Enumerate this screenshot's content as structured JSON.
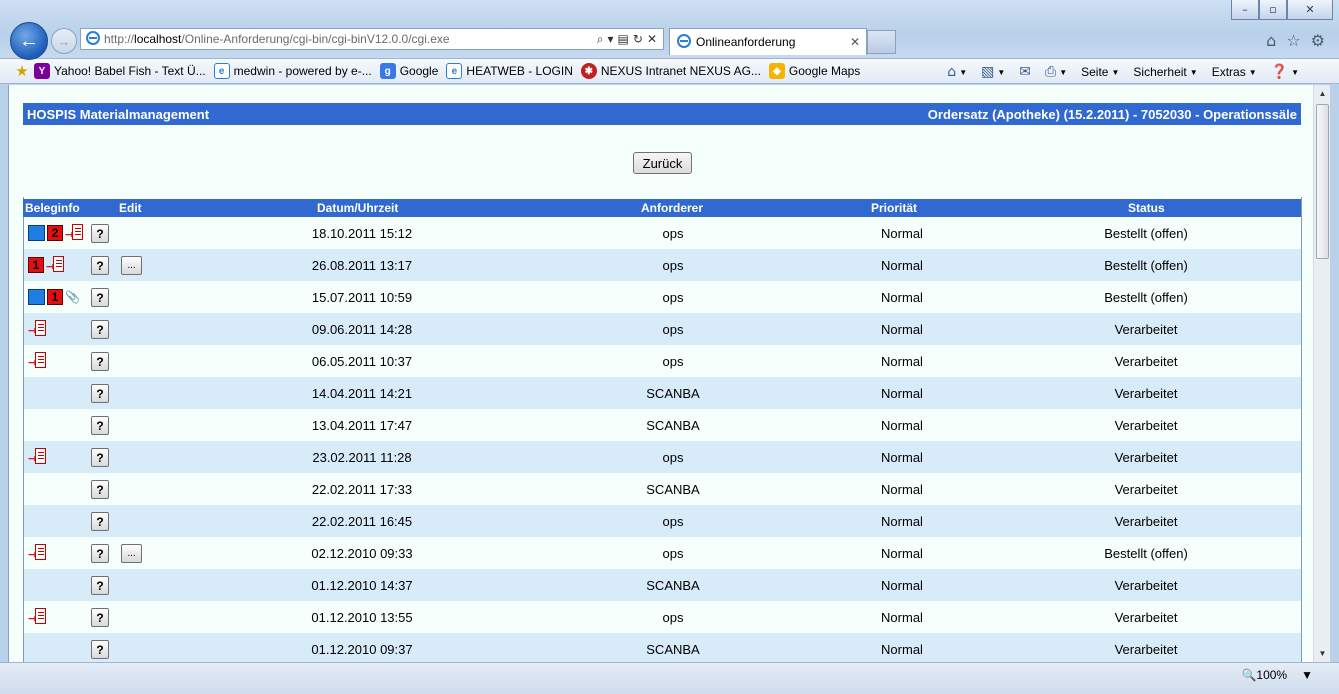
{
  "browser": {
    "address_prefix": "http://",
    "address_host": "localhost",
    "address_path": "/Online-Anforderung/cgi-bin/cgi-binV12.0.0/cgi.exe",
    "tab_title": "Onlineanforderung",
    "favorites": [
      {
        "label": "Yahoo! Babel Fish - Text Ü..."
      },
      {
        "label": "medwin - powered by e-..."
      },
      {
        "label": "Google"
      },
      {
        "label": "HEATWEB - LOGIN"
      },
      {
        "label": "NEXUS Intranet NEXUS AG..."
      },
      {
        "label": "Google Maps"
      }
    ],
    "commands": {
      "page": "Seite",
      "safety": "Sicherheit",
      "extras": "Extras"
    },
    "zoom": "100%"
  },
  "page": {
    "app_title": "HOSPIS Materialmanagement",
    "context": "Ordersatz (Apotheke) (15.2.2011) - 7052030 - Operationssäle",
    "back_button": "Zurück",
    "columns": {
      "beleginfo": "Beleginfo",
      "edit": "Edit",
      "datetime": "Datum/Uhrzeit",
      "requester": "Anforderer",
      "priority": "Priorität",
      "status": "Status"
    },
    "question_label": "?",
    "edit_label": "...",
    "rows": [
      {
        "beleg": [
          "box",
          "num:2",
          "doc"
        ],
        "edit": false,
        "datetime": "18.10.2011 15:12",
        "requester": "ops",
        "priority": "Normal",
        "status": "Bestellt (offen)"
      },
      {
        "beleg": [
          "num:1",
          "doc"
        ],
        "edit": true,
        "datetime": "26.08.2011 13:17",
        "requester": "ops",
        "priority": "Normal",
        "status": "Bestellt (offen)"
      },
      {
        "beleg": [
          "box",
          "num:1",
          "clip"
        ],
        "edit": false,
        "datetime": "15.07.2011 10:59",
        "requester": "ops",
        "priority": "Normal",
        "status": "Bestellt (offen)"
      },
      {
        "beleg": [
          "doc"
        ],
        "edit": false,
        "datetime": "09.06.2011 14:28",
        "requester": "ops",
        "priority": "Normal",
        "status": "Verarbeitet"
      },
      {
        "beleg": [
          "doc"
        ],
        "edit": false,
        "datetime": "06.05.2011 10:37",
        "requester": "ops",
        "priority": "Normal",
        "status": "Verarbeitet"
      },
      {
        "beleg": [],
        "edit": false,
        "datetime": "14.04.2011 14:21",
        "requester": "SCANBA",
        "priority": "Normal",
        "status": "Verarbeitet"
      },
      {
        "beleg": [],
        "edit": false,
        "datetime": "13.04.2011 17:47",
        "requester": "SCANBA",
        "priority": "Normal",
        "status": "Verarbeitet"
      },
      {
        "beleg": [
          "doc"
        ],
        "edit": false,
        "datetime": "23.02.2011 11:28",
        "requester": "ops",
        "priority": "Normal",
        "status": "Verarbeitet"
      },
      {
        "beleg": [],
        "edit": false,
        "datetime": "22.02.2011 17:33",
        "requester": "SCANBA",
        "priority": "Normal",
        "status": "Verarbeitet"
      },
      {
        "beleg": [],
        "edit": false,
        "datetime": "22.02.2011 16:45",
        "requester": "ops",
        "priority": "Normal",
        "status": "Verarbeitet"
      },
      {
        "beleg": [
          "doc"
        ],
        "edit": true,
        "datetime": "02.12.2010 09:33",
        "requester": "ops",
        "priority": "Normal",
        "status": "Bestellt (offen)"
      },
      {
        "beleg": [],
        "edit": false,
        "datetime": "01.12.2010 14:37",
        "requester": "SCANBA",
        "priority": "Normal",
        "status": "Verarbeitet"
      },
      {
        "beleg": [
          "doc"
        ],
        "edit": false,
        "datetime": "01.12.2010 13:55",
        "requester": "ops",
        "priority": "Normal",
        "status": "Verarbeitet"
      },
      {
        "beleg": [],
        "edit": false,
        "datetime": "01.12.2010 09:37",
        "requester": "SCANBA",
        "priority": "Normal",
        "status": "Verarbeitet"
      }
    ]
  },
  "colors": {
    "header_blue": "#3169d0",
    "row_alt": "#d8ebf8",
    "row_base": "#f5fffc",
    "badge_red": "#e01010",
    "badge_blue": "#1f7fe0"
  }
}
